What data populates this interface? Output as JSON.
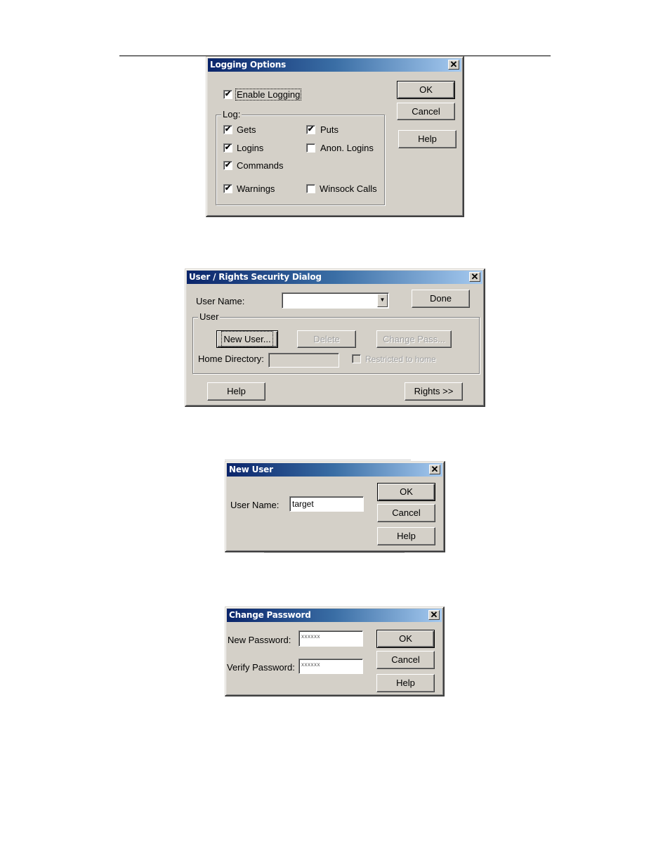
{
  "logging_options": {
    "title": "Logging Options",
    "enable_logging": {
      "label": "Enable Logging",
      "checked": true
    },
    "log_group_label": "Log:",
    "log_items": [
      {
        "label": "Gets",
        "checked": true
      },
      {
        "label": "Puts",
        "checked": true
      },
      {
        "label": "Logins",
        "checked": true
      },
      {
        "label": "Anon. Logins",
        "checked": false
      },
      {
        "label": "Commands",
        "checked": true
      },
      {
        "label": "Warnings",
        "checked": true
      },
      {
        "label": "Winsock Calls",
        "checked": false
      }
    ],
    "buttons": {
      "ok": "OK",
      "cancel": "Cancel",
      "help": "Help"
    }
  },
  "user_rights_dialog": {
    "title": "User / Rights Security Dialog",
    "user_name_label": "User Name:",
    "user_name_value": "",
    "user_group_label": "User",
    "buttons": {
      "done": "Done",
      "new_user": "New User...",
      "delete": "Delete",
      "change_pass": "Change Pass...",
      "help": "Help",
      "rights": "Rights >>"
    },
    "home_directory_label": "Home Directory:",
    "home_directory_value": "",
    "restricted_to_home": {
      "label": "Restricted to home",
      "checked": false,
      "enabled": false
    }
  },
  "new_user_dialog": {
    "title": "New User",
    "user_name_label": "User Name:",
    "user_name_value": "target",
    "buttons": {
      "ok": "OK",
      "cancel": "Cancel",
      "help": "Help"
    }
  },
  "change_password_dialog": {
    "title": "Change Password",
    "new_password_label": "New Password:",
    "new_password_value": "xxxxxx",
    "verify_password_label": "Verify Password:",
    "verify_password_value": "xxxxxx",
    "buttons": {
      "ok": "OK",
      "cancel": "Cancel",
      "help": "Help"
    }
  },
  "icons": {
    "close": "✕",
    "check": "✔",
    "dropdown": "▼"
  }
}
